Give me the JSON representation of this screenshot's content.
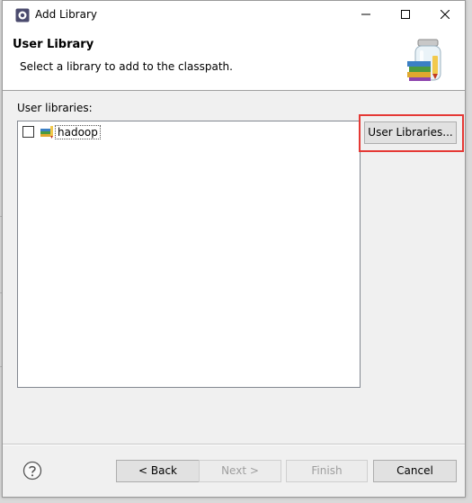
{
  "window": {
    "title": "Add Library"
  },
  "titlebar": {
    "icons": [
      "eclipse-icon",
      "minimize-icon",
      "maximize-icon",
      "close-icon"
    ]
  },
  "header": {
    "title": "User Library",
    "description": "Select a library to add to the classpath.",
    "image": "library-jars-icon"
  },
  "list": {
    "label": "User libraries:",
    "items": [
      {
        "label": "hadoop",
        "checked": false,
        "icon": "library-icon"
      }
    ]
  },
  "buttons": {
    "user_libraries": "User Libraries...",
    "back": "< Back",
    "next": "Next >",
    "finish": "Finish",
    "cancel": "Cancel"
  },
  "footer": {
    "help_icon": "help-icon"
  },
  "colors": {
    "highlight": "#e53935",
    "dialog_bg": "#f0f0f0",
    "header_bg": "#ffffff"
  }
}
